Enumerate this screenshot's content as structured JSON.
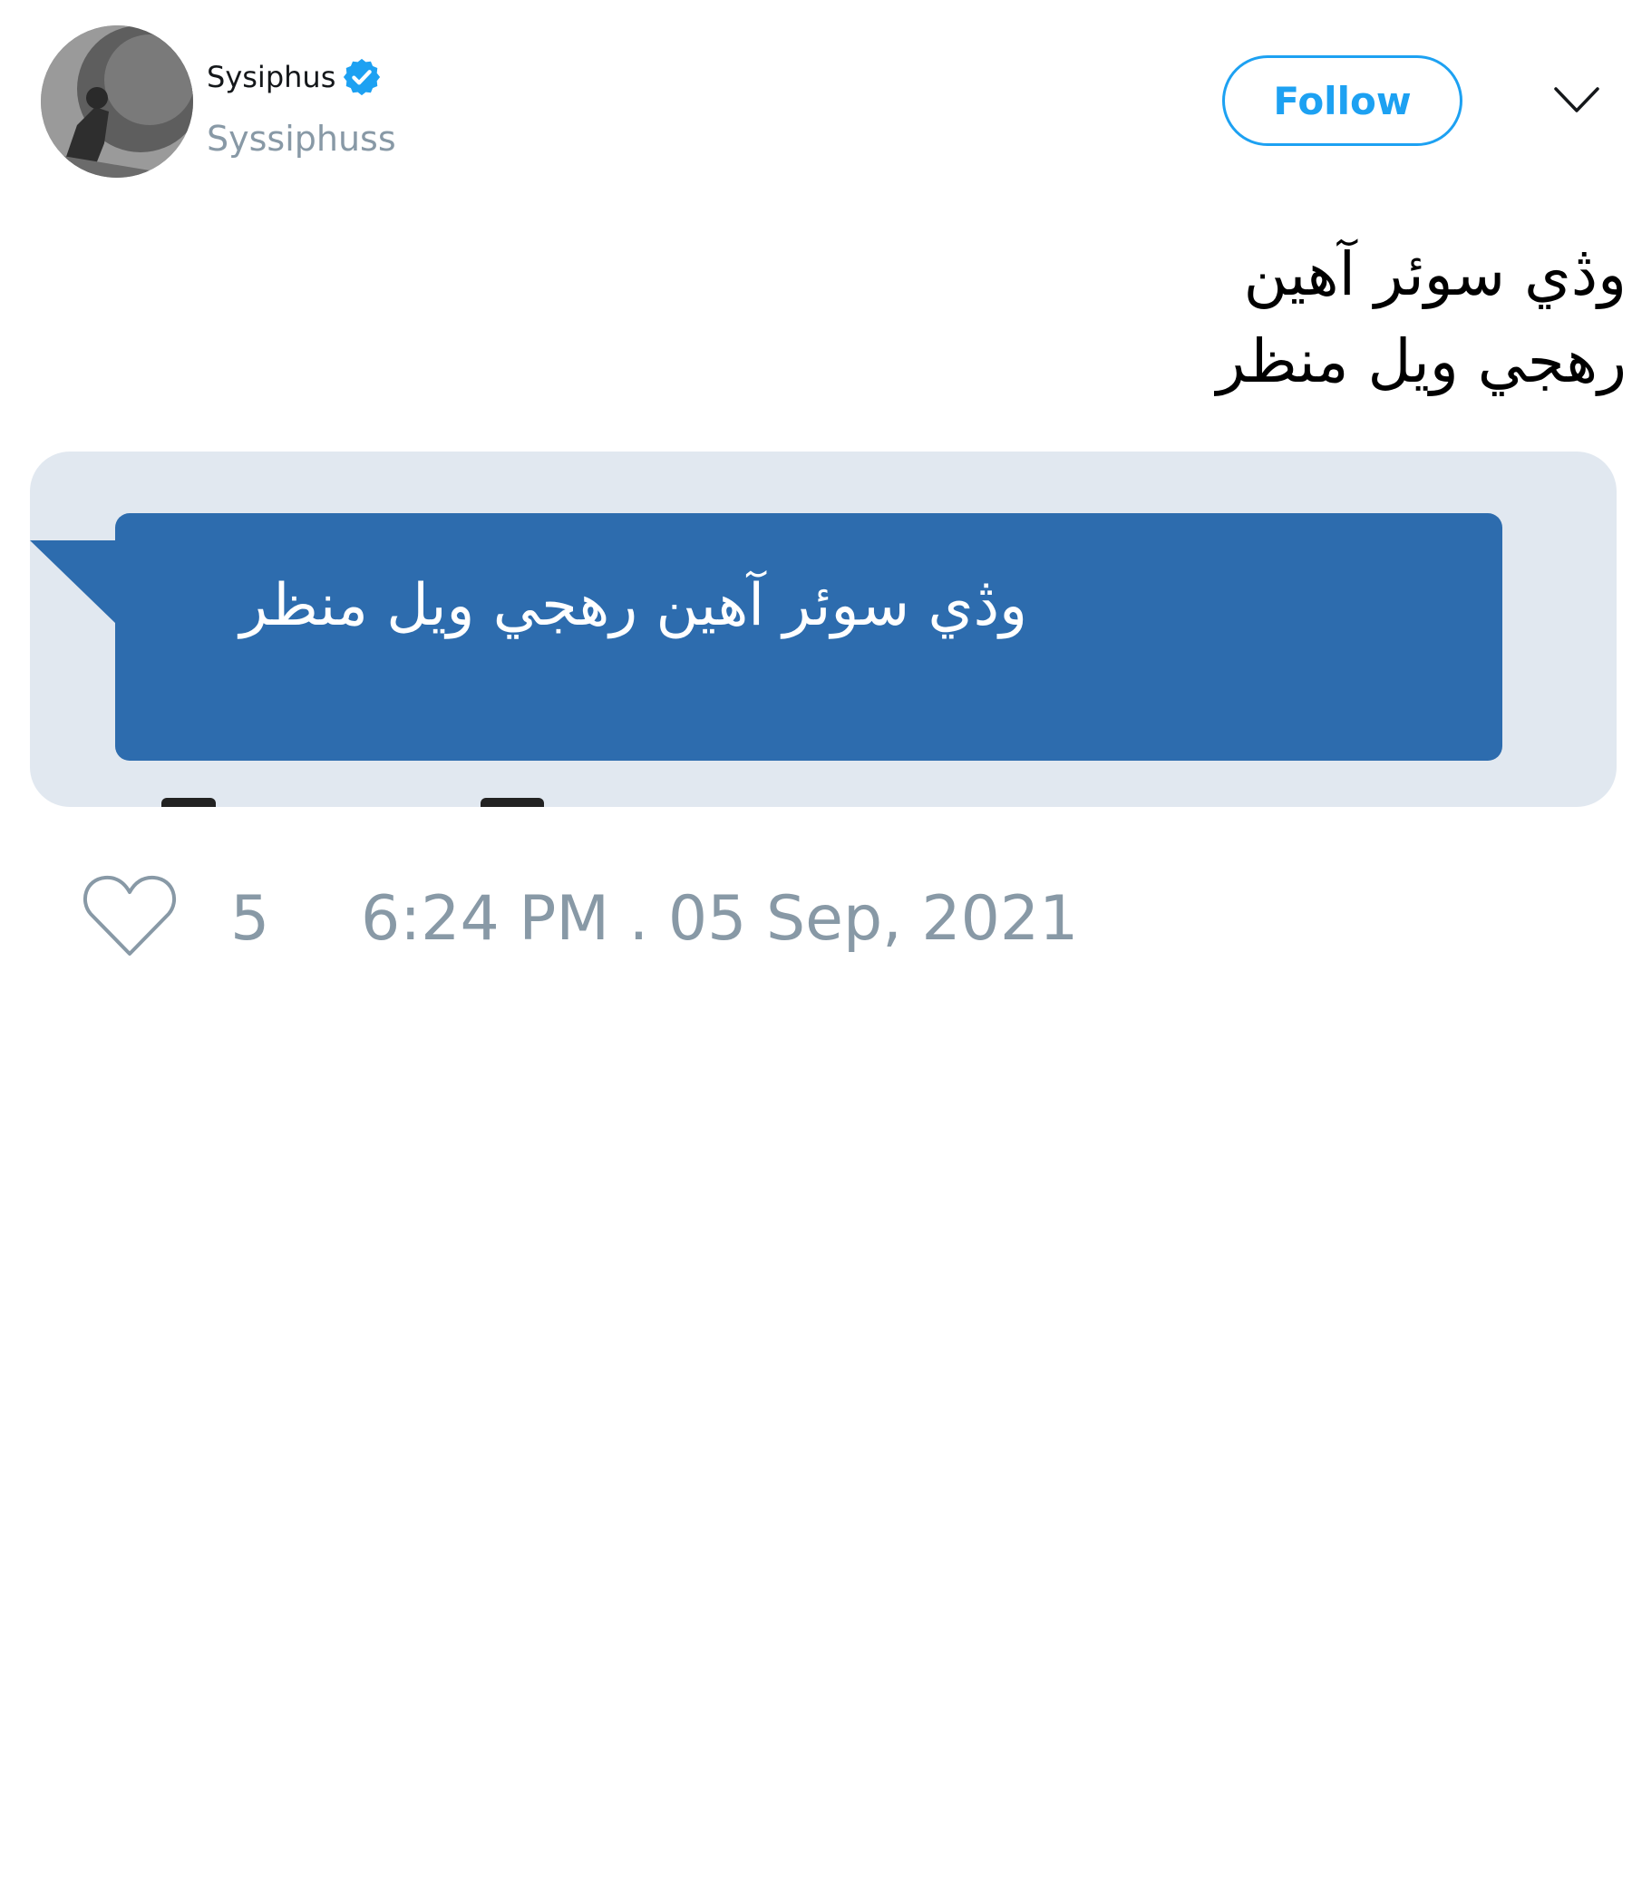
{
  "user": {
    "display_name": "Sysiphus",
    "handle": "Syssiphuss",
    "verified": true,
    "avatar_icon": "sisyphus-avatar"
  },
  "actions": {
    "follow_label": "Follow",
    "menu_icon": "chevron-down-icon"
  },
  "tweet": {
    "lines": [
      "وڎي سوئر آهين",
      "رهجي ويل منظر"
    ]
  },
  "media": {
    "bubble_text": "وڎي سوئر آهين رهجي ويل منظر",
    "bubble_color": "#2d6cae",
    "card_color": "#e1e8f0"
  },
  "footer": {
    "like_icon": "heart-icon",
    "like_count": "5",
    "timestamp": "6:24 PM . 05 Sep, 2021"
  },
  "colors": {
    "accent": "#1da1f2",
    "muted": "#8899a6"
  }
}
